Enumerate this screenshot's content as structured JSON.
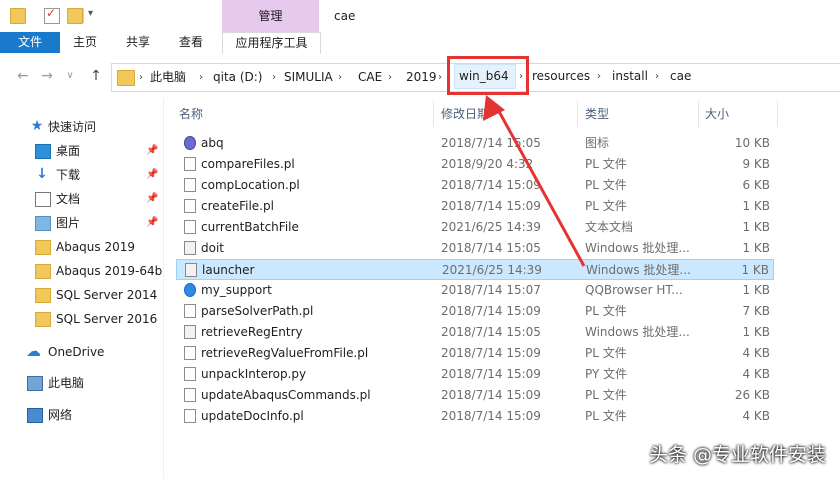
{
  "window": {
    "title": "cae",
    "manage_tab": "管理"
  },
  "ribbon": {
    "tabs": [
      {
        "label": "文件",
        "active": true
      },
      {
        "label": "主页"
      },
      {
        "label": "共享"
      },
      {
        "label": "查看"
      },
      {
        "label": "应用程序工具"
      }
    ]
  },
  "nav_buttons": {
    "back": "←",
    "forward": "→",
    "dropdown": "∨",
    "up": "↑"
  },
  "breadcrumb": [
    "此电脑",
    "qita (D:)",
    "SIMULIA",
    "CAE",
    "2019",
    "win_b64",
    "resources",
    "install",
    "cae"
  ],
  "breadcrumb_separator": "›",
  "sidebar": {
    "items": [
      {
        "label": "快速访问",
        "icon": "star-icon"
      },
      {
        "label": "桌面",
        "icon": "desktop-icon",
        "pinned": true
      },
      {
        "label": "下载",
        "icon": "download-icon",
        "pinned": true
      },
      {
        "label": "文档",
        "icon": "documents-icon",
        "pinned": true
      },
      {
        "label": "图片",
        "icon": "pictures-icon",
        "pinned": true
      },
      {
        "label": "Abaqus 2019",
        "icon": "folder-icon"
      },
      {
        "label": "Abaqus 2019-64b",
        "icon": "folder-icon"
      },
      {
        "label": "SQL Server 2014",
        "icon": "folder-icon"
      },
      {
        "label": "SQL Server 2016",
        "icon": "folder-icon"
      },
      {
        "label": "OneDrive",
        "icon": "onedrive-icon"
      },
      {
        "label": "此电脑",
        "icon": "computer-icon",
        "selected": true
      },
      {
        "label": "网络",
        "icon": "network-icon"
      }
    ]
  },
  "columns": {
    "name": "名称",
    "date": "修改日期",
    "type": "类型",
    "size": "大小"
  },
  "files": [
    {
      "name": "abq",
      "date": "2018/7/14 15:05",
      "type": "图标",
      "size": "10 KB",
      "icon": "exe"
    },
    {
      "name": "compareFiles.pl",
      "date": "2018/9/20 4:32",
      "type": "PL 文件",
      "size": "9 KB",
      "icon": "file"
    },
    {
      "name": "compLocation.pl",
      "date": "2018/7/14 15:09",
      "type": "PL 文件",
      "size": "6 KB",
      "icon": "file"
    },
    {
      "name": "createFile.pl",
      "date": "2018/7/14 15:09",
      "type": "PL 文件",
      "size": "1 KB",
      "icon": "file"
    },
    {
      "name": "currentBatchFile",
      "date": "2021/6/25 14:39",
      "type": "文本文档",
      "size": "1 KB",
      "icon": "file"
    },
    {
      "name": "doit",
      "date": "2018/7/14 15:05",
      "type": "Windows 批处理...",
      "size": "1 KB",
      "icon": "bat"
    },
    {
      "name": "launcher",
      "date": "2021/6/25 14:39",
      "type": "Windows 批处理...",
      "size": "1 KB",
      "icon": "bat",
      "selected": true
    },
    {
      "name": "my_support",
      "date": "2018/7/14 15:07",
      "type": "QQBrowser HT...",
      "size": "1 KB",
      "icon": "qq"
    },
    {
      "name": "parseSolverPath.pl",
      "date": "2018/7/14 15:09",
      "type": "PL 文件",
      "size": "7 KB",
      "icon": "file"
    },
    {
      "name": "retrieveRegEntry",
      "date": "2018/7/14 15:05",
      "type": "Windows 批处理...",
      "size": "1 KB",
      "icon": "bat"
    },
    {
      "name": "retrieveRegValueFromFile.pl",
      "date": "2018/7/14 15:09",
      "type": "PL 文件",
      "size": "4 KB",
      "icon": "file"
    },
    {
      "name": "unpackInterop.py",
      "date": "2018/7/14 15:09",
      "type": "PY 文件",
      "size": "4 KB",
      "icon": "file"
    },
    {
      "name": "updateAbaqusCommands.pl",
      "date": "2018/7/14 15:09",
      "type": "PL 文件",
      "size": "26 KB",
      "icon": "file"
    },
    {
      "name": "updateDocInfo.pl",
      "date": "2018/7/14 15:09",
      "type": "PL 文件",
      "size": "4 KB",
      "icon": "file"
    }
  ],
  "watermark": "头条 @专业软件安装",
  "colors": {
    "accent": "#1979ca",
    "selection": "#cce8ff",
    "annotation": "#e53232",
    "manage": "#e7c9ee"
  }
}
